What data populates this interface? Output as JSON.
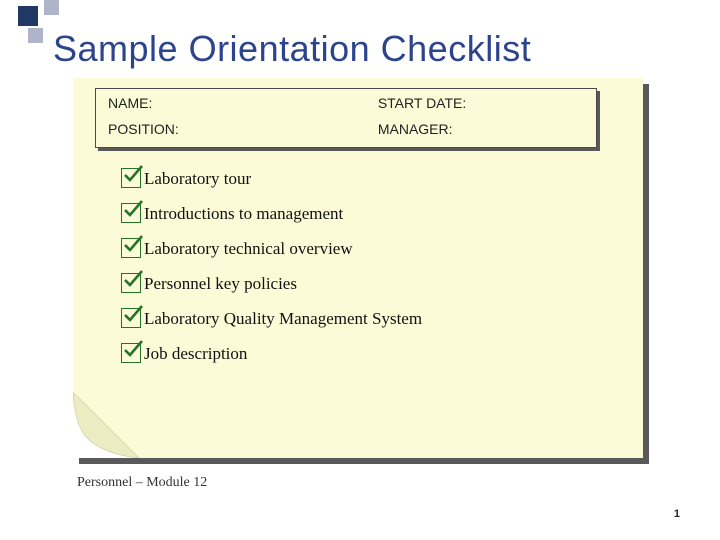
{
  "title": "Sample Orientation Checklist",
  "info": {
    "name_label": "NAME:",
    "start_date_label": "START DATE:",
    "position_label": "POSITION:",
    "manager_label": "MANAGER:"
  },
  "checklist": {
    "items": [
      {
        "label": "Laboratory tour"
      },
      {
        "label": "Introductions to management"
      },
      {
        "label": "Laboratory technical overview"
      },
      {
        "label": "Personnel key policies"
      },
      {
        "label": "Laboratory Quality Management System"
      },
      {
        "label": "Job description"
      }
    ]
  },
  "footer": "Personnel – Module 12",
  "page_number": "1"
}
